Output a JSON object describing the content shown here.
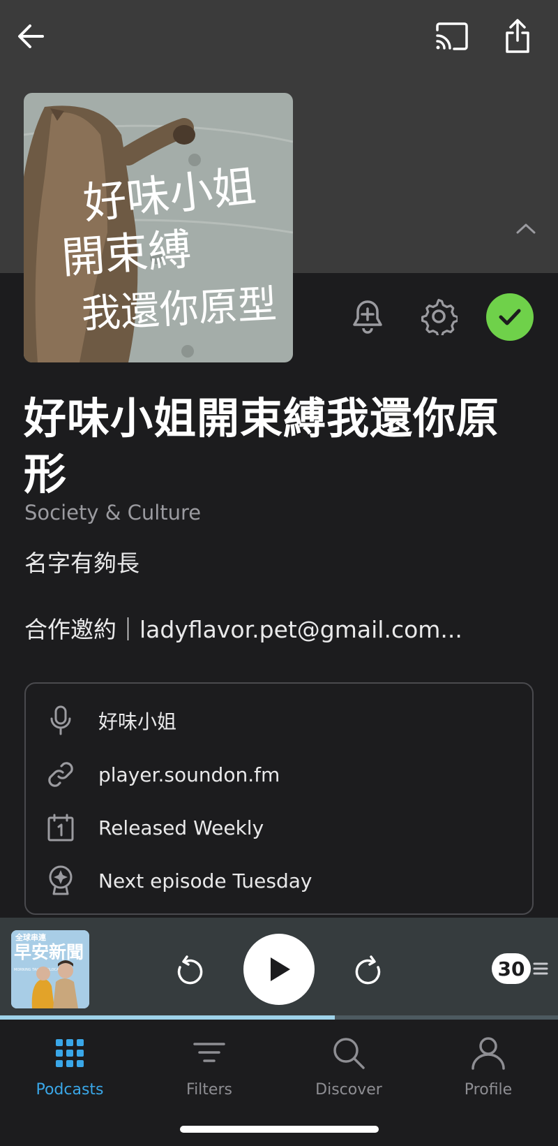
{
  "header": {
    "icons": [
      "back-arrow-icon",
      "cast-icon",
      "share-icon",
      "chevron-up-icon"
    ]
  },
  "podcast": {
    "cover_text": [
      "好味小姐",
      "開束縛",
      "我還你原型"
    ],
    "title": "好味小姐開束縛我還你原形",
    "category": "Society & Culture",
    "description_line1": "名字有夠長",
    "description_line2": "合作邀約｜ladyflavor.pet@gmail.com...",
    "subscribed": true,
    "accent_color": "#6fd14a"
  },
  "info": [
    {
      "icon": "microphone-icon",
      "text": "好味小姐"
    },
    {
      "icon": "link-icon",
      "text": "player.soundon.fm"
    },
    {
      "icon": "calendar-icon",
      "text": "Released Weekly"
    },
    {
      "icon": "next-episode-icon",
      "text": "Next episode Tuesday"
    }
  ],
  "player": {
    "art_title": "早安新聞",
    "art_top": "全球串連",
    "art_side": "MORNING TAIWAN GLOCAL NEWS",
    "queue_count": "30",
    "progress_fraction": 0.6,
    "progress_color": "#9fd3ea"
  },
  "tabs": [
    {
      "label": "Podcasts",
      "icon": "grid-icon",
      "active": true
    },
    {
      "label": "Filters",
      "icon": "filter-icon",
      "active": false
    },
    {
      "label": "Discover",
      "icon": "search-icon",
      "active": false
    },
    {
      "label": "Profile",
      "icon": "profile-icon",
      "active": false
    }
  ],
  "colors": {
    "active_tab": "#3aa7e8",
    "inactive_tab": "#8e8e93"
  }
}
